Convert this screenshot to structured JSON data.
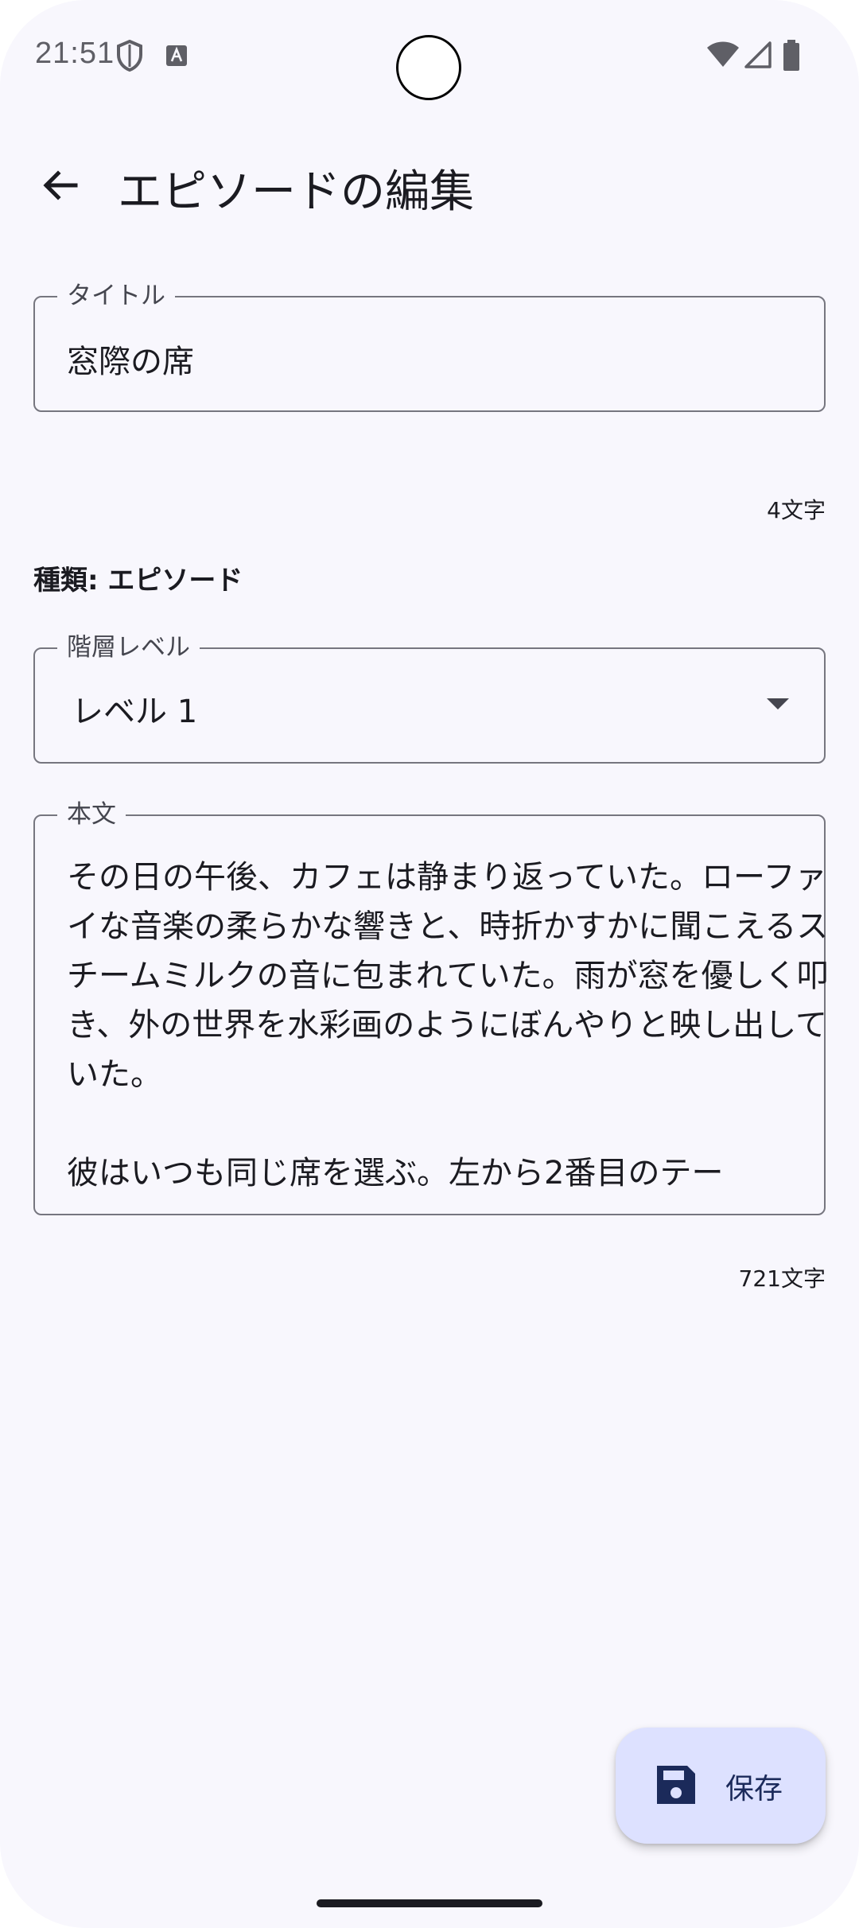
{
  "status_bar": {
    "time": "21:51",
    "icons": [
      "shield-icon",
      "keyboard-a-icon",
      "wifi-icon",
      "signal-icon",
      "battery-icon"
    ]
  },
  "app_bar": {
    "title": "エピソードの編集",
    "back_icon": "arrow-back-icon"
  },
  "form": {
    "title_field": {
      "label": "タイトル",
      "value": "窓際の席",
      "counter": "4文字"
    },
    "kind": "種類: エピソード",
    "level_field": {
      "label": "階層レベル",
      "value": "レベル 1"
    },
    "body_field": {
      "label": "本文",
      "value": "その日の午後、カフェは静まり返っていた。ローファイな音楽の柔らかな響きと、時折かすかに聞こえるスチームミルクの音に包まれていた。雨が窓を優しく叩き、外の世界を水彩画のようにぼんやりと映し出していた。\n\n彼はいつも同じ席を選ぶ。左から2番目のテー",
      "counter": "721文字"
    }
  },
  "fab": {
    "label": "保存",
    "icon": "save-icon"
  },
  "colors": {
    "background": "#f8f7fd",
    "outline": "#76767f",
    "fab_container": "#dde1ff",
    "fab_content": "#1b2a5a"
  }
}
